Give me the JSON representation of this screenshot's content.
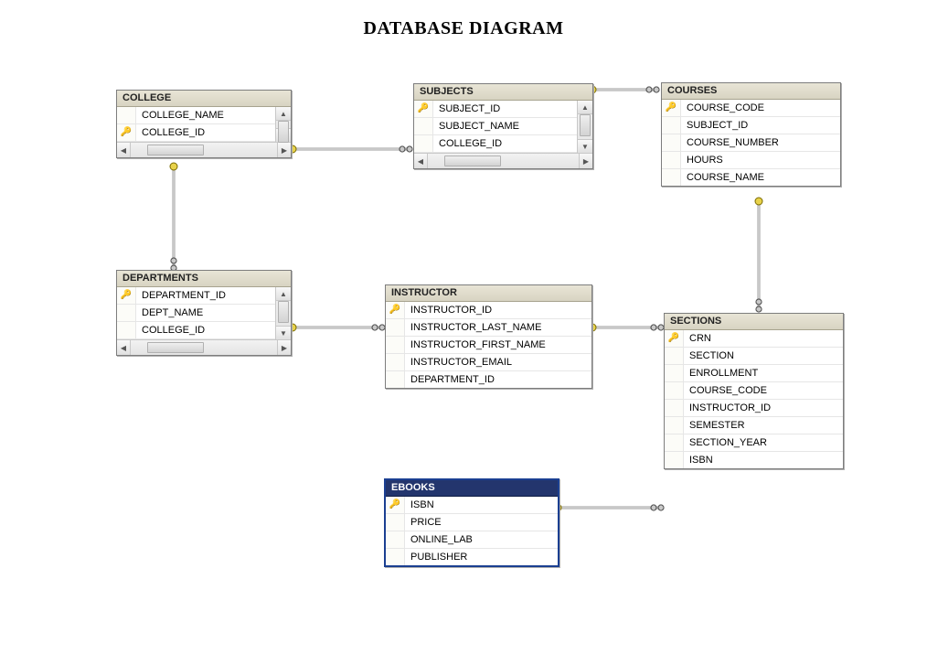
{
  "title": "DATABASE DIAGRAM",
  "tables": {
    "college": {
      "name": "COLLEGE",
      "columns": [
        {
          "name": "COLLEGE_NAME",
          "pk": false
        },
        {
          "name": "COLLEGE_ID",
          "pk": true
        }
      ]
    },
    "subjects": {
      "name": "SUBJECTS",
      "columns": [
        {
          "name": "SUBJECT_ID",
          "pk": true
        },
        {
          "name": "SUBJECT_NAME",
          "pk": false
        },
        {
          "name": "COLLEGE_ID",
          "pk": false
        }
      ]
    },
    "courses": {
      "name": "COURSES",
      "columns": [
        {
          "name": "COURSE_CODE",
          "pk": true
        },
        {
          "name": "SUBJECT_ID",
          "pk": false
        },
        {
          "name": "COURSE_NUMBER",
          "pk": false
        },
        {
          "name": "HOURS",
          "pk": false
        },
        {
          "name": "COURSE_NAME",
          "pk": false
        }
      ]
    },
    "departments": {
      "name": "DEPARTMENTS",
      "columns": [
        {
          "name": "DEPARTMENT_ID",
          "pk": true
        },
        {
          "name": "DEPT_NAME",
          "pk": false
        },
        {
          "name": "COLLEGE_ID",
          "pk": false
        }
      ]
    },
    "instructor": {
      "name": "INSTRUCTOR",
      "columns": [
        {
          "name": "INSTRUCTOR_ID",
          "pk": true
        },
        {
          "name": "INSTRUCTOR_LAST_NAME",
          "pk": false
        },
        {
          "name": "INSTRUCTOR_FIRST_NAME",
          "pk": false
        },
        {
          "name": "INSTRUCTOR_EMAIL",
          "pk": false
        },
        {
          "name": "DEPARTMENT_ID",
          "pk": false
        }
      ]
    },
    "sections": {
      "name": "SECTIONS",
      "columns": [
        {
          "name": "CRN",
          "pk": true
        },
        {
          "name": "SECTION",
          "pk": false
        },
        {
          "name": "ENROLLMENT",
          "pk": false
        },
        {
          "name": "COURSE_CODE",
          "pk": false
        },
        {
          "name": "INSTRUCTOR_ID",
          "pk": false
        },
        {
          "name": "SEMESTER",
          "pk": false
        },
        {
          "name": "SECTION_YEAR",
          "pk": false
        },
        {
          "name": "ISBN",
          "pk": false
        }
      ]
    },
    "ebooks": {
      "name": "EBOOKS",
      "columns": [
        {
          "name": "ISBN",
          "pk": true
        },
        {
          "name": "PRICE",
          "pk": false
        },
        {
          "name": "ONLINE_LAB",
          "pk": false
        },
        {
          "name": "PUBLISHER",
          "pk": false
        }
      ]
    }
  },
  "relationships": [
    {
      "from": "COLLEGE.COLLEGE_ID",
      "to": "SUBJECTS.COLLEGE_ID"
    },
    {
      "from": "COLLEGE.COLLEGE_ID",
      "to": "DEPARTMENTS.COLLEGE_ID"
    },
    {
      "from": "SUBJECTS.SUBJECT_ID",
      "to": "COURSES.SUBJECT_ID"
    },
    {
      "from": "DEPARTMENTS.DEPARTMENT_ID",
      "to": "INSTRUCTOR.DEPARTMENT_ID"
    },
    {
      "from": "INSTRUCTOR.INSTRUCTOR_ID",
      "to": "SECTIONS.INSTRUCTOR_ID"
    },
    {
      "from": "COURSES.COURSE_CODE",
      "to": "SECTIONS.COURSE_CODE"
    },
    {
      "from": "EBOOKS.ISBN",
      "to": "SECTIONS.ISBN"
    }
  ]
}
